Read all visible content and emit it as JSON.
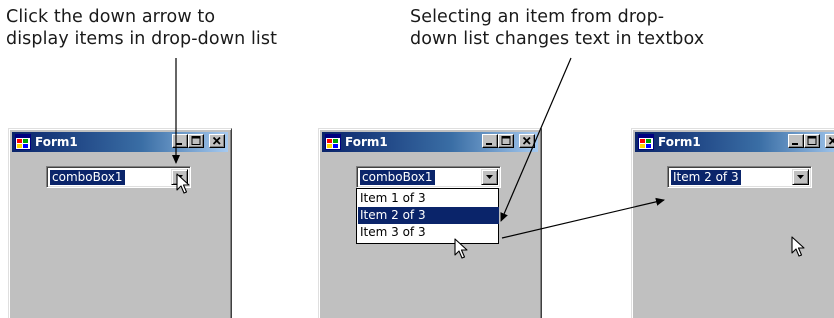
{
  "captions": {
    "left": [
      "Click the down arrow to",
      "display items in drop-down list"
    ],
    "right": [
      "Selecting an item from drop-",
      "down list changes text in textbox"
    ]
  },
  "windows": [
    {
      "title": "Form1",
      "combo_text": "comboBox1"
    },
    {
      "title": "Form1",
      "combo_text": "comboBox1",
      "dropdown_items": [
        "Item 1 of 3",
        "Item 2 of 3",
        "Item 3 of 3"
      ],
      "selected_index": 1
    },
    {
      "title": "Form1",
      "combo_text": "Item 2 of 3"
    }
  ],
  "colors": {
    "selection": "#0a246a",
    "titlebar_start": "#0a246a",
    "titlebar_end": "#a6caf0",
    "window_face": "#c0c0c0"
  },
  "icons": [
    "form-app-icon",
    "minimize-icon",
    "maximize-icon",
    "close-icon",
    "dropdown-arrow-icon",
    "mouse-pointer-icon",
    "annotation-arrow"
  ]
}
